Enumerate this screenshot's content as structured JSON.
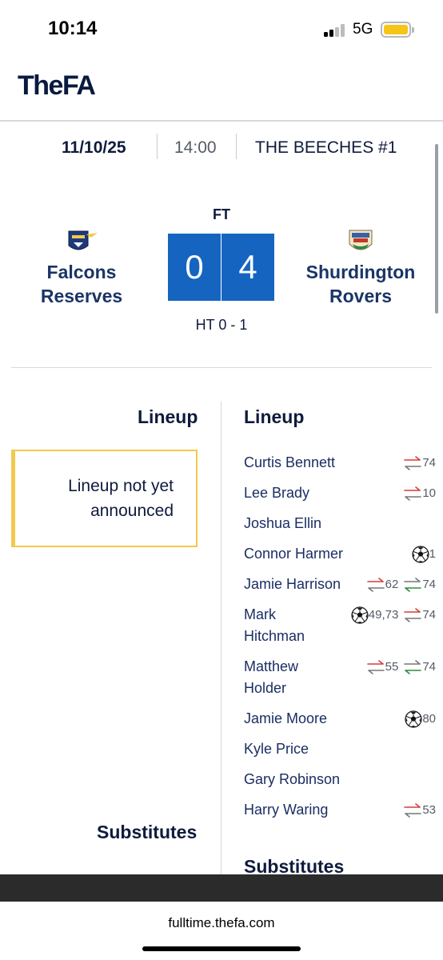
{
  "status_bar": {
    "time": "10:14",
    "network": "5G"
  },
  "header": {
    "logo": "TheFA"
  },
  "match": {
    "date": "11/10/25",
    "time": "14:00",
    "venue": "THE BEECHES #1",
    "status": "FT",
    "home_team": {
      "name_line1": "Falcons",
      "name_line2": "Reserves",
      "score": "0"
    },
    "away_team": {
      "name_line1": "Shurdington",
      "name_line2": "Rovers",
      "score": "4"
    },
    "half_time": "HT 0 - 1"
  },
  "home_lineup": {
    "heading": "Lineup",
    "notice_line1": "Lineup not yet",
    "notice_line2": "announced",
    "substitutes_heading": "Substitutes"
  },
  "away_lineup": {
    "heading": "Lineup",
    "substitutes_heading": "Substitutes",
    "players": [
      {
        "name": "Curtis Bennett",
        "events": [
          {
            "type": "sub-off",
            "label": "74"
          }
        ]
      },
      {
        "name": "Lee Brady",
        "events": [
          {
            "type": "sub-off",
            "label": "10"
          }
        ]
      },
      {
        "name": "Joshua Ellin",
        "events": []
      },
      {
        "name": "Connor Harmer",
        "events": [
          {
            "type": "goal",
            "label": "1"
          }
        ]
      },
      {
        "name": "Jamie Harrison",
        "events": [
          {
            "type": "sub-off",
            "label": "62"
          },
          {
            "type": "sub-on",
            "label": "74"
          }
        ]
      },
      {
        "name_line1": "Mark",
        "name_line2": "Hitchman",
        "events": [
          {
            "type": "goal",
            "label": "49,73"
          },
          {
            "type": "sub-off",
            "label": "74"
          }
        ]
      },
      {
        "name_line1": "Matthew",
        "name_line2": "Holder",
        "events": [
          {
            "type": "sub-off",
            "label": "55"
          },
          {
            "type": "sub-on",
            "label": "74"
          }
        ]
      },
      {
        "name": "Jamie Moore",
        "events": [
          {
            "type": "goal",
            "label": "80"
          }
        ]
      },
      {
        "name": "Kyle Price",
        "events": []
      },
      {
        "name": "Gary Robinson",
        "events": []
      },
      {
        "name": "Harry Waring",
        "events": [
          {
            "type": "sub-off",
            "label": "53"
          }
        ]
      }
    ]
  },
  "footer": {
    "url": "fulltime.thefa.com"
  },
  "colors": {
    "score_blue": "#1565c0",
    "notice_border": "#f2c94c",
    "sub_off_red": "#d93a3a",
    "sub_on_green": "#2e8b3e",
    "battery": "#f5c518"
  },
  "icons": {
    "goal": "football-icon",
    "sub_off": "substitution-off-icon",
    "sub_on": "substitution-on-icon"
  }
}
